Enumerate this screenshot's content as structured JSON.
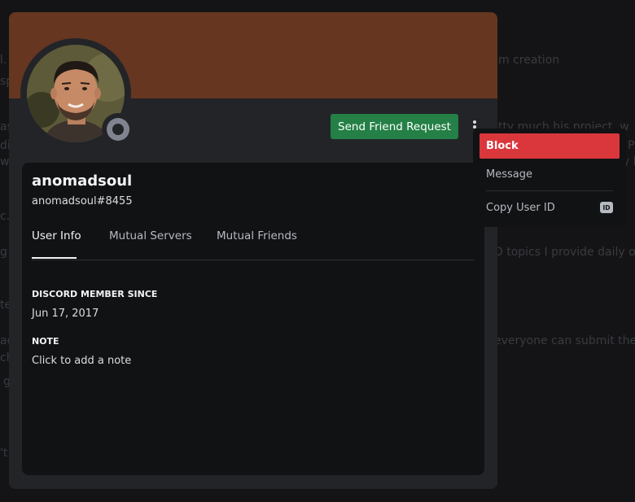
{
  "background": {
    "lines": [
      "l. L",
      "sp",
      "as",
      "di",
      "w",
      "c.",
      "g",
      "te",
      "ac",
      "ch",
      "g",
      "'t",
      "m creation",
      "pretty much his project, w",
      "P",
      "y l",
      "D topics I provide daily o",
      "everyone can submit their"
    ]
  },
  "colors": {
    "banner": "#663620",
    "friend_button": "#248046",
    "danger": "#da373c",
    "status_offline": "#80848e"
  },
  "profile": {
    "display_name": "anomadsoul",
    "username": "anomadsoul#8455",
    "send_friend_request_label": "Send Friend Request",
    "more_icon": "vertical-ellipsis-icon",
    "status": "offline"
  },
  "tabs": [
    {
      "label": "User Info",
      "active": true
    },
    {
      "label": "Mutual Servers",
      "active": false
    },
    {
      "label": "Mutual Friends",
      "active": false
    }
  ],
  "sections": {
    "member_since_title": "DISCORD MEMBER SINCE",
    "member_since_value": "Jun 17, 2017",
    "note_title": "NOTE",
    "note_placeholder": "Click to add a note"
  },
  "menu": {
    "block_label": "Block",
    "message_label": "Message",
    "copy_id_label": "Copy User ID",
    "copy_id_badge": "ID"
  }
}
